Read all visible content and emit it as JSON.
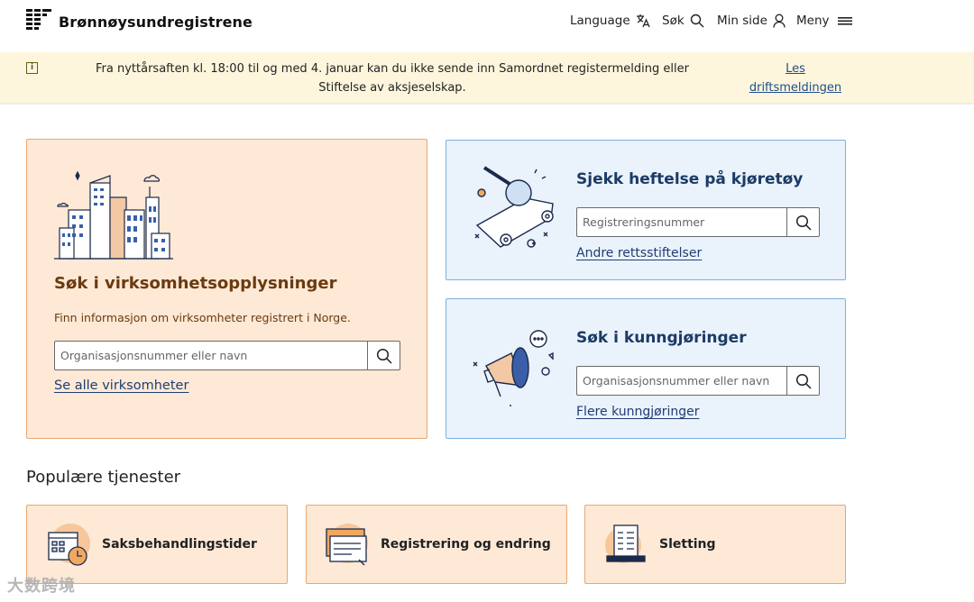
{
  "header": {
    "logo_text": "Brønnøysundregistrene",
    "nav": {
      "language": "Language",
      "search": "Søk",
      "my_page": "Min side",
      "menu": "Meny"
    }
  },
  "banner": {
    "text": "Fra nyttårsaften kl. 18:00 til og med 4. januar kan du ikke sende inn Samordnet registermelding eller Stiftelse av aksjeselskap.",
    "link": "Les driftsmeldingen"
  },
  "company_search": {
    "title": "Søk i virksomhetsopplysninger",
    "description": "Finn informasjon om virksomheter registrert i Norge.",
    "placeholder": "Organisasjonsnummer eller navn",
    "link": "Se alle virksomheter"
  },
  "vehicle_search": {
    "title": "Sjekk heftelse på kjøretøy",
    "placeholder": "Registreringsnummer",
    "link": "Andre rettsstiftelser"
  },
  "announcement_search": {
    "title": "Søk i kunngjøringer",
    "placeholder": "Organisasjonsnummer eller navn",
    "link": "Flere kunngjøringer"
  },
  "popular": {
    "title": "Populære tjenester",
    "items": [
      {
        "label": "Saksbehandlingstider",
        "icon": "calendar-clock-icon"
      },
      {
        "label": "Registrering og endring",
        "icon": "forms-icon"
      },
      {
        "label": "Sletting",
        "icon": "document-deletion-icon"
      }
    ]
  },
  "watermark": "大数跨境",
  "colors": {
    "brand_orange_bg": "#fde9d6",
    "brand_blue_bg": "#eaf2fb",
    "banner_bg": "#fdf6dd",
    "link": "#1f3e73"
  }
}
